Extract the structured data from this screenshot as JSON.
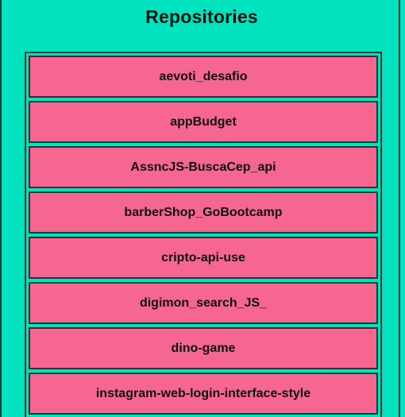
{
  "page": {
    "title": "Repositories"
  },
  "repos": [
    {
      "name": "aevoti_desafio"
    },
    {
      "name": "appBudget"
    },
    {
      "name": "AssncJS-BuscaCep_api"
    },
    {
      "name": "barberShop_GoBootcamp"
    },
    {
      "name": "cripto-api-use"
    },
    {
      "name": "digimon_search_JS_"
    },
    {
      "name": "dino-game"
    },
    {
      "name": "instagram-web-login-interface-style"
    }
  ],
  "colors": {
    "background": "#00e3bf",
    "item": "#f56690",
    "border": "#1f3a35"
  }
}
